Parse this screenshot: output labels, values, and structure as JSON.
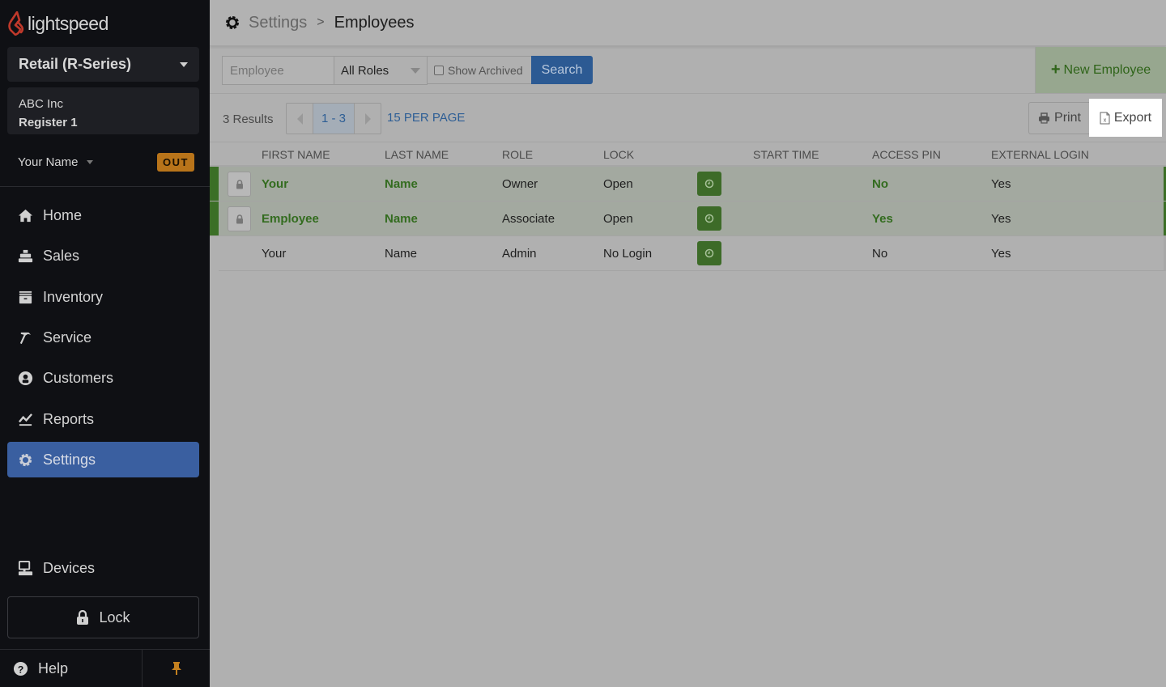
{
  "sidebar": {
    "logo_text": "lightspeed",
    "product": "Retail (R-Series)",
    "store_name": "ABC Inc",
    "register": "Register 1",
    "user_name": "Your Name",
    "clock_status": "OUT",
    "nav": [
      {
        "label": "Home",
        "icon": "home-icon"
      },
      {
        "label": "Sales",
        "icon": "register-icon"
      },
      {
        "label": "Inventory",
        "icon": "inventory-icon"
      },
      {
        "label": "Service",
        "icon": "hammer-icon"
      },
      {
        "label": "Customers",
        "icon": "customer-icon"
      },
      {
        "label": "Reports",
        "icon": "chart-icon"
      },
      {
        "label": "Settings",
        "icon": "gear-icon",
        "active": true
      }
    ],
    "devices": "Devices",
    "lock": "Lock",
    "help": "Help"
  },
  "header": {
    "parent": "Settings",
    "separator": ">",
    "current": "Employees"
  },
  "filters": {
    "search_value": "",
    "search_placeholder": "Employee",
    "role_selected": "All Roles",
    "show_archived_label": "Show Archived",
    "show_archived_checked": false,
    "search_button": "Search",
    "new_employee_button": "New Employee"
  },
  "pager": {
    "results": "3 Results",
    "range": "1 - 3",
    "per_page": "15 PER PAGE",
    "print": "Print",
    "export": "Export"
  },
  "table": {
    "columns": [
      "FIRST NAME",
      "LAST NAME",
      "ROLE",
      "LOCK",
      "START TIME",
      "ACCESS PIN",
      "EXTERNAL LOGIN"
    ],
    "rows": [
      {
        "first": "Your",
        "last": "Name",
        "role": "Owner",
        "lock": "Open",
        "start_time": "",
        "access_pin": "No",
        "external_login": "Yes",
        "highlighted": true,
        "lockable": true
      },
      {
        "first": "Employee",
        "last": "Name",
        "role": "Associate",
        "lock": "Open",
        "start_time": "",
        "access_pin": "Yes",
        "external_login": "Yes",
        "highlighted": true,
        "lockable": true
      },
      {
        "first": "Your",
        "last": "Name",
        "role": "Admin",
        "lock": "No Login",
        "start_time": "",
        "access_pin": "No",
        "external_login": "Yes",
        "highlighted": false,
        "lockable": false
      }
    ]
  },
  "colors": {
    "sidebar_bg": "#0f1014",
    "active_nav": "#3a5fa0",
    "accent_green": "#3b6f26",
    "link_blue": "#2d5e95",
    "out_badge": "#b8741a"
  }
}
